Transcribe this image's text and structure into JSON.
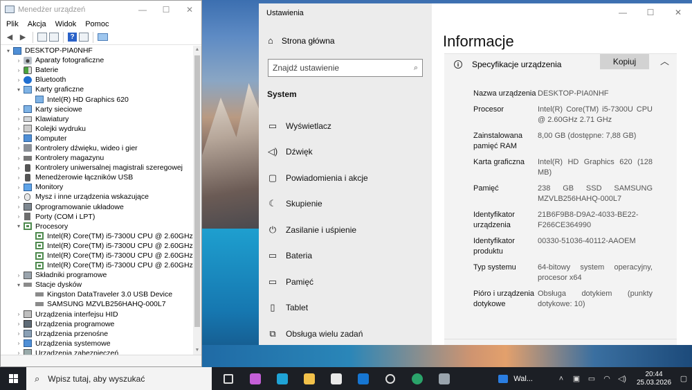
{
  "device_manager": {
    "title": "Menedżer urządzeń",
    "menu": [
      "Plik",
      "Akcja",
      "Widok",
      "Pomoc"
    ],
    "tree": [
      {
        "label": "DESKTOP-PIA0NHF",
        "level": 0,
        "toggle": "▾",
        "icon": "computer-icon"
      },
      {
        "label": "Aparaty fotograficzne",
        "level": 1,
        "toggle": "›",
        "icon": "camera-icon"
      },
      {
        "label": "Baterie",
        "level": 1,
        "toggle": "›",
        "icon": "battery-icon"
      },
      {
        "label": "Bluetooth",
        "level": 1,
        "toggle": "›",
        "icon": "bluetooth-icon"
      },
      {
        "label": "Karty graficzne",
        "level": 1,
        "toggle": "▾",
        "icon": "display-adapter-icon"
      },
      {
        "label": "Intel(R) HD Graphics 620",
        "level": 2,
        "toggle": "",
        "icon": "display-adapter-icon"
      },
      {
        "label": "Karty sieciowe",
        "level": 1,
        "toggle": "›",
        "icon": "network-icon"
      },
      {
        "label": "Klawiatury",
        "level": 1,
        "toggle": "›",
        "icon": "keyboard-icon"
      },
      {
        "label": "Kolejki wydruku",
        "level": 1,
        "toggle": "›",
        "icon": "print-queue-icon"
      },
      {
        "label": "Komputer",
        "level": 1,
        "toggle": "›",
        "icon": "computer-icon"
      },
      {
        "label": "Kontrolery dźwięku, wideo i gier",
        "level": 1,
        "toggle": "›",
        "icon": "speaker-icon"
      },
      {
        "label": "Kontrolery magazynu",
        "level": 1,
        "toggle": "›",
        "icon": "storage-controller-icon"
      },
      {
        "label": "Kontrolery uniwersalnej magistrali szeregowej",
        "level": 1,
        "toggle": "›",
        "icon": "usb-icon"
      },
      {
        "label": "Menedżerowie łączników USB",
        "level": 1,
        "toggle": "›",
        "icon": "usb-icon"
      },
      {
        "label": "Monitory",
        "level": 1,
        "toggle": "›",
        "icon": "monitor-icon"
      },
      {
        "label": "Mysz i inne urządzenia wskazujące",
        "level": 1,
        "toggle": "›",
        "icon": "mouse-icon"
      },
      {
        "label": "Oprogramowanie układowe",
        "level": 1,
        "toggle": "›",
        "icon": "firmware-icon"
      },
      {
        "label": "Porty (COM i LPT)",
        "level": 1,
        "toggle": "›",
        "icon": "port-icon"
      },
      {
        "label": "Procesory",
        "level": 1,
        "toggle": "▾",
        "icon": "processor-icon"
      },
      {
        "label": "Intel(R) Core(TM) i5-7300U CPU @ 2.60GHz",
        "level": 2,
        "toggle": "",
        "icon": "processor-icon"
      },
      {
        "label": "Intel(R) Core(TM) i5-7300U CPU @ 2.60GHz",
        "level": 2,
        "toggle": "",
        "icon": "processor-icon"
      },
      {
        "label": "Intel(R) Core(TM) i5-7300U CPU @ 2.60GHz",
        "level": 2,
        "toggle": "",
        "icon": "processor-icon"
      },
      {
        "label": "Intel(R) Core(TM) i5-7300U CPU @ 2.60GHz",
        "level": 2,
        "toggle": "",
        "icon": "processor-icon"
      },
      {
        "label": "Składniki programowe",
        "level": 1,
        "toggle": "›",
        "icon": "software-component-icon"
      },
      {
        "label": "Stacje dysków",
        "level": 1,
        "toggle": "▾",
        "icon": "disk-drive-icon"
      },
      {
        "label": "Kingston DataTraveler 3.0 USB Device",
        "level": 2,
        "toggle": "",
        "icon": "disk-drive-icon"
      },
      {
        "label": "SAMSUNG MZVLB256HAHQ-000L7",
        "level": 2,
        "toggle": "",
        "icon": "disk-drive-icon"
      },
      {
        "label": "Urządzenia interfejsu HID",
        "level": 1,
        "toggle": "›",
        "icon": "hid-icon"
      },
      {
        "label": "Urządzenia programowe",
        "level": 1,
        "toggle": "›",
        "icon": "software-device-icon"
      },
      {
        "label": "Urządzenia przenośne",
        "level": 1,
        "toggle": "›",
        "icon": "portable-device-icon"
      },
      {
        "label": "Urządzenia systemowe",
        "level": 1,
        "toggle": "›",
        "icon": "system-device-icon"
      },
      {
        "label": "Urządzenia zabezpieczeń",
        "level": 1,
        "toggle": "›",
        "icon": "security-device-icon"
      }
    ]
  },
  "settings": {
    "app_title": "Ustawienia",
    "home_label": "Strona główna",
    "search_placeholder": "Znajdź ustawienie",
    "section_title": "System",
    "nav": [
      {
        "label": "Wyświetlacz",
        "icon": "display-icon",
        "glyph": "▭"
      },
      {
        "label": "Dźwięk",
        "icon": "speaker-icon",
        "glyph": "◁)"
      },
      {
        "label": "Powiadomienia i akcje",
        "icon": "notifications-icon",
        "glyph": "▢"
      },
      {
        "label": "Skupienie",
        "icon": "focus-assist-icon",
        "glyph": "☾"
      },
      {
        "label": "Zasilanie i uśpienie",
        "icon": "power-icon",
        "glyph": "⏻"
      },
      {
        "label": "Bateria",
        "icon": "battery-icon",
        "glyph": "▭"
      },
      {
        "label": "Pamięć",
        "icon": "storage-icon",
        "glyph": "▭"
      },
      {
        "label": "Tablet",
        "icon": "tablet-icon",
        "glyph": "▯"
      },
      {
        "label": "Obsługa wielu zadań",
        "icon": "multitasking-icon",
        "glyph": "⧉"
      }
    ],
    "page_title": "Informacje",
    "spec_section_label": "Specyfikacje urządzenia",
    "copy_label": "Kopiuj",
    "specs": [
      {
        "key": "Nazwa urządzenia",
        "value": "DESKTOP-PIA0NHF"
      },
      {
        "key": "Procesor",
        "value": "Intel(R) Core(TM) i5-7300U CPU @ 2.60GHz 2.71 GHz"
      },
      {
        "key": "Zainstalowana pamięć RAM",
        "value": "8,00 GB (dostępne: 7,88 GB)"
      },
      {
        "key": "Karta graficzna",
        "value": "Intel(R) HD Graphics 620 (128 MB)"
      },
      {
        "key": "Pamięć",
        "value": "238 GB SSD SAMSUNG MZVLB256HAHQ-000L7"
      },
      {
        "key": "Identyfikator urządzenia",
        "value": "21B6F9B8-D9A2-4033-BE22-F266CE364990"
      },
      {
        "key": "Identyfikator produktu",
        "value": "00330-51036-40112-AAOEM"
      },
      {
        "key": "Typ systemu",
        "value": "64-bitowy system operacyjny, procesor x64"
      },
      {
        "key": "Pióro i urządzenia dotykowe",
        "value": "Obsługa dotykiem (punkty dotykowe: 10)"
      }
    ]
  },
  "taskbar": {
    "search_placeholder": "Wpisz tutaj, aby wyszukać",
    "apps": [
      {
        "name": "task-view-icon",
        "color": "#1c1f25"
      },
      {
        "name": "copilot-icon",
        "color": "#c45fd8"
      },
      {
        "name": "edge-icon",
        "color": "#1fa3d6"
      },
      {
        "name": "file-explorer-icon",
        "color": "#f2c14a"
      },
      {
        "name": "store-icon",
        "color": "#e9e9e9"
      },
      {
        "name": "outlook-icon",
        "color": "#1676d2"
      },
      {
        "name": "settings-icon",
        "color": "#1c1f25"
      },
      {
        "name": "app-circle-icon",
        "color": "#2aa36a"
      },
      {
        "name": "device-manager-icon",
        "color": "#9aa4ad"
      }
    ],
    "weather_label": "Wal...",
    "time": "20:44",
    "date": "25.03.2026"
  }
}
